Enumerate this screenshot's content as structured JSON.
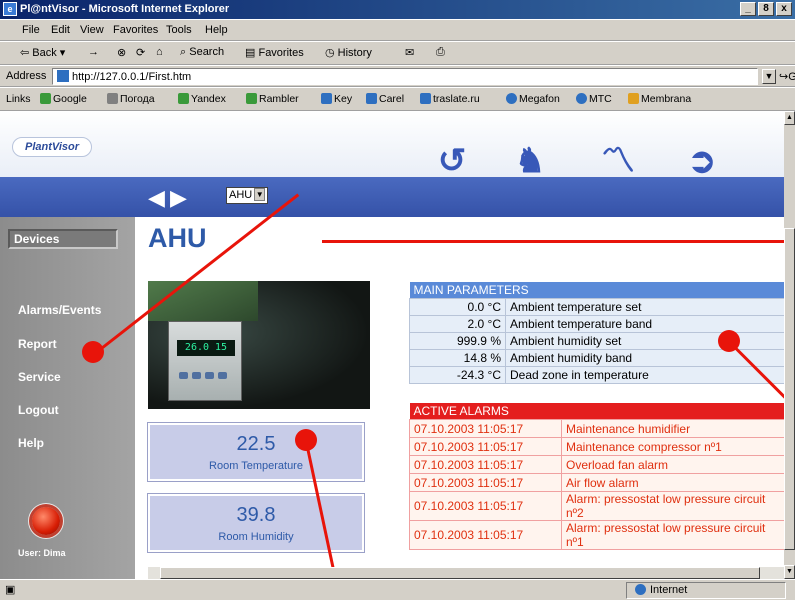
{
  "window": {
    "title": "Pl@ntVisor - Microsoft Internet Explorer",
    "controls": [
      "_",
      "8",
      "x"
    ]
  },
  "menu": [
    "File",
    "Edit",
    "View",
    "Favorites",
    "Tools",
    "Help"
  ],
  "toolbar": {
    "back": "Back",
    "forward": "→",
    "stop": "⊗",
    "refresh": "⟳",
    "home": "⌂",
    "search": "Search",
    "favorites": "Favorites",
    "history": "History",
    "mail": "✉",
    "print": "⎙"
  },
  "address": {
    "label": "Address",
    "url": "http://127.0.0.1/First.htm",
    "go": "Go"
  },
  "links": {
    "label": "Links",
    "items": [
      "Google",
      "Погода",
      "Yandex",
      "Rambler",
      "Key",
      "Carel",
      "traslate.ru",
      "Megafon",
      "MTC",
      "Membrana"
    ]
  },
  "brand": {
    "logo": "PlantVisor"
  },
  "nav": {
    "selected_device": "AHU",
    "prev": "◀",
    "next": "▶"
  },
  "sidebar": {
    "devices": "Devices",
    "items": [
      "Alarms/Events",
      "Report",
      "Service",
      "Logout",
      "Help"
    ],
    "user": "User: Dima"
  },
  "page": {
    "title": "AHU",
    "lcd_reading": "26.0 15"
  },
  "readings": [
    {
      "value": "22.5",
      "label": "Room Temperature"
    },
    {
      "value": "39.8",
      "label": "Room Humidity"
    }
  ],
  "main_parameters": {
    "header": "MAIN PARAMETERS",
    "rows": [
      {
        "value": "0.0 °C",
        "name": "Ambient temperature set"
      },
      {
        "value": "2.0 °C",
        "name": "Ambient temperature band"
      },
      {
        "value": "999.9 %",
        "name": "Ambient humidity set"
      },
      {
        "value": "14.8 %",
        "name": "Ambient humidity band"
      },
      {
        "value": "-24.3 °C",
        "name": "Dead zone in temperature"
      }
    ]
  },
  "active_alarms": {
    "header": "ACTIVE ALARMS",
    "rows": [
      {
        "time": "07.10.2003 11:05:17",
        "text": "Maintenance humidifier"
      },
      {
        "time": "07.10.2003 11:05:17",
        "text": "Maintenance compressor nº1"
      },
      {
        "time": "07.10.2003 11:05:17",
        "text": "Overload fan alarm"
      },
      {
        "time": "07.10.2003 11:05:17",
        "text": "Air flow alarm"
      },
      {
        "time": "07.10.2003 11:05:17",
        "text": "Alarm: pressostat low pressure circuit nº2"
      },
      {
        "time": "07.10.2003 11:05:17",
        "text": "Alarm: pressostat low pressure circuit nº1"
      }
    ]
  },
  "status": {
    "zone": "Internet"
  },
  "colors": {
    "accent": "#2e5aa8",
    "alarm": "#e41e1e",
    "annotation": "#e8140a"
  }
}
